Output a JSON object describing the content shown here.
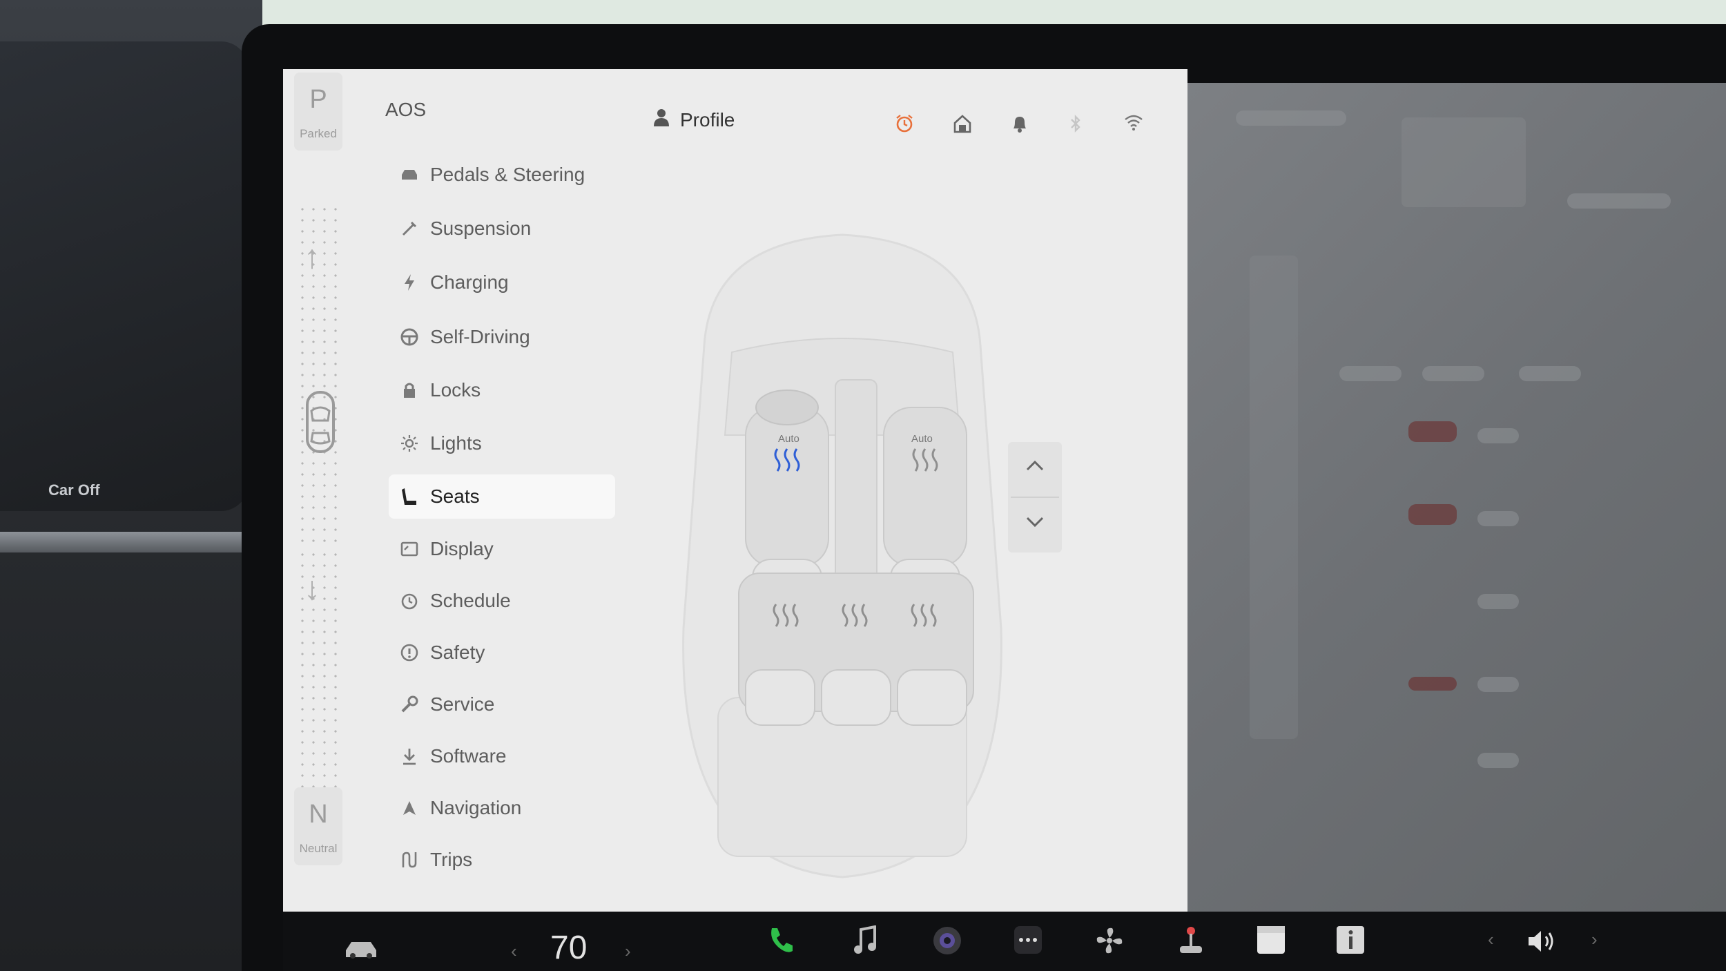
{
  "dashboard": {
    "car_off_label": "Car Off"
  },
  "gear": {
    "top_letter": "P",
    "top_label": "Parked",
    "bottom_letter": "N",
    "bottom_label": "Neutral"
  },
  "header": {
    "title": "AOS",
    "profile_label": "Profile",
    "status_icons": [
      "alarm-icon",
      "home-icon",
      "bell-icon",
      "bluetooth-icon",
      "wifi-icon"
    ],
    "alarm_color": "#e8703a"
  },
  "menu": {
    "selected": "Seats",
    "items": [
      {
        "label": "Pedals & Steering",
        "icon": "car-icon"
      },
      {
        "label": "Suspension",
        "icon": "wrench-pencil-icon"
      },
      {
        "label": "Charging",
        "icon": "lightning-icon"
      },
      {
        "label": "Self-Driving",
        "icon": "steering-wheel-icon"
      },
      {
        "label": "Locks",
        "icon": "lock-icon"
      },
      {
        "label": "Lights",
        "icon": "sun-icon"
      },
      {
        "label": "Seats",
        "icon": "seat-icon"
      },
      {
        "label": "Display",
        "icon": "display-icon"
      },
      {
        "label": "Schedule",
        "icon": "clock-icon"
      },
      {
        "label": "Safety",
        "icon": "info-circle-icon"
      },
      {
        "label": "Service",
        "icon": "wrench-icon"
      },
      {
        "label": "Software",
        "icon": "download-icon"
      },
      {
        "label": "Navigation",
        "icon": "navigation-arrow-icon"
      },
      {
        "label": "Trips",
        "icon": "trips-icon"
      }
    ]
  },
  "seats": {
    "driver_mode": "Auto",
    "passenger_mode": "Auto",
    "active_heat_color": "#2f5fd6"
  },
  "taskbar": {
    "temperature": "70",
    "phone_color": "#2fbf4a"
  }
}
